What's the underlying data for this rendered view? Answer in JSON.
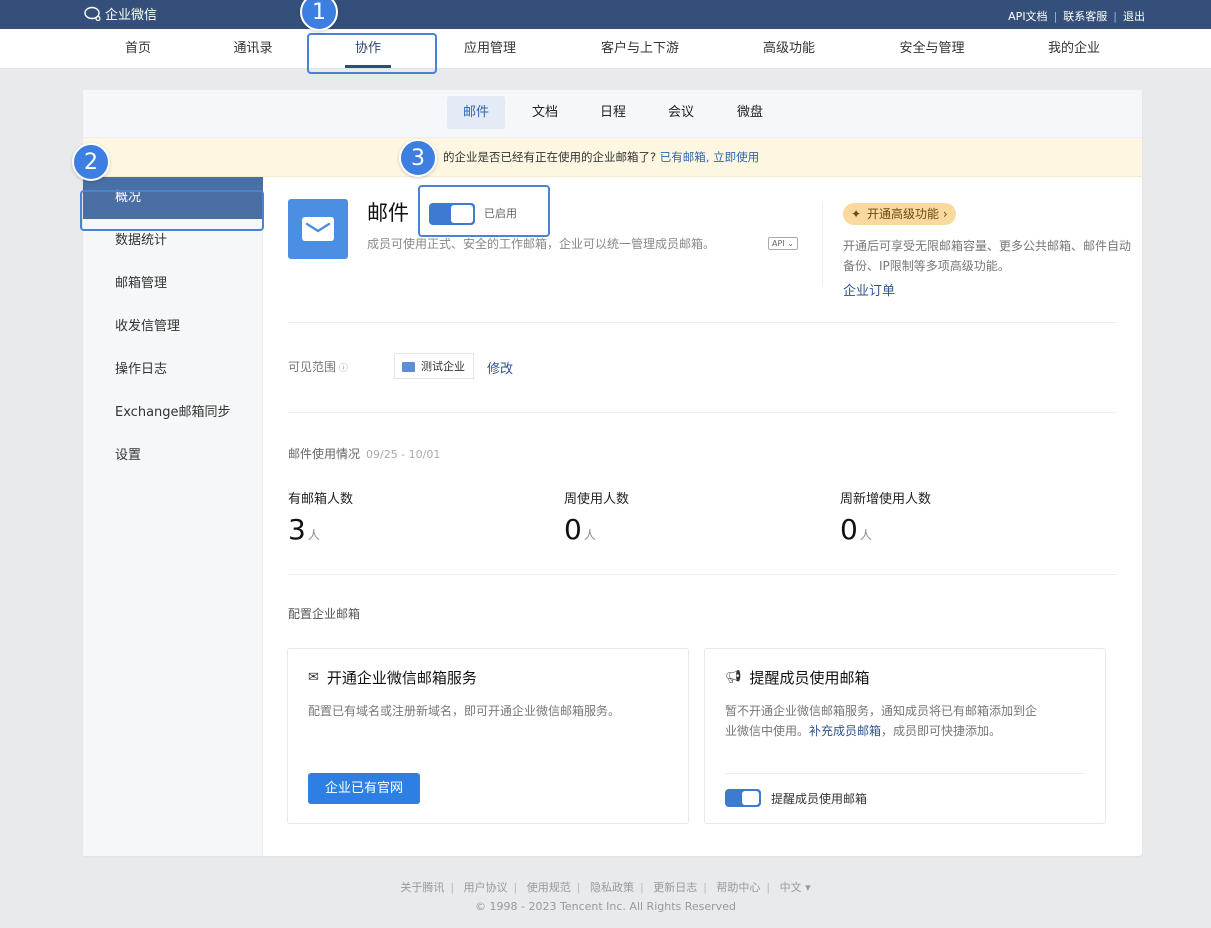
{
  "topbar": {
    "logo_text": "企业微信",
    "links": [
      "API文档",
      "联系客服",
      "退出"
    ]
  },
  "main_nav": {
    "items": [
      "首页",
      "通讯录",
      "协作",
      "应用管理",
      "客户与上下游",
      "高级功能",
      "安全与管理",
      "我的企业"
    ],
    "active": "协作"
  },
  "annotations": [
    "1",
    "2",
    "3"
  ],
  "sub_nav": {
    "items": [
      "邮件",
      "文档",
      "日程",
      "会议",
      "微盘"
    ],
    "active": "邮件"
  },
  "notice": {
    "text": "的企业是否已经有正在使用的企业邮箱了?",
    "link_text": "已有邮箱, 立即使用"
  },
  "sidebar": {
    "items": [
      "概况",
      "数据统计",
      "邮箱管理",
      "收发信管理",
      "操作日志",
      "Exchange邮箱同步",
      "设置"
    ],
    "active": "概况"
  },
  "app": {
    "title": "邮件",
    "status": "已启用",
    "description": "成员可使用正式、安全的工作邮箱，企业可以统一管理成员邮箱。",
    "api_tag": "API"
  },
  "upgrade": {
    "label": "开通高级功能 ›",
    "description": "开通后可享受无限邮箱容量、更多公共邮箱、邮件自动备份、IP限制等多项高级功能。",
    "order_link": "企业订单"
  },
  "visibility": {
    "label": "可见范围",
    "org": "测试企业",
    "edit": "修改"
  },
  "usage": {
    "title": "邮件使用情况",
    "range": "09/25 - 10/01",
    "unit": "人",
    "stats": [
      {
        "label": "有邮箱人数",
        "value": "3"
      },
      {
        "label": "周使用人数",
        "value": "0"
      },
      {
        "label": "周新增使用人数",
        "value": "0"
      }
    ]
  },
  "config": {
    "title": "配置企业邮箱",
    "card_open": {
      "title": "开通企业微信邮箱服务",
      "description": "配置已有域名或注册新域名，即可开通企业微信邮箱服务。",
      "button": "企业已有官网"
    },
    "card_remind": {
      "title": "提醒成员使用邮箱",
      "desc_line1": "暂不开通企业微信邮箱服务，通知成员将已有邮箱添加到企",
      "desc_line2_pre": "业微信中使用。",
      "desc_link": "补充成员邮箱",
      "desc_line2_post": "，成员即可快捷添加。",
      "toggle_label": "提醒成员使用邮箱"
    }
  },
  "footer": {
    "links": [
      "关于腾讯",
      "用户协议",
      "使用规范",
      "隐私政策",
      "更新日志",
      "帮助中心",
      "中文 ▾"
    ],
    "copyright": "© 1998 - 2023 Tencent Inc. All Rights Reserved"
  },
  "colors": {
    "topbar": "#34507a",
    "accent": "#3d7fe0",
    "sidebar_active": "#4a6fa5",
    "primary_button": "#2e7fe4"
  }
}
